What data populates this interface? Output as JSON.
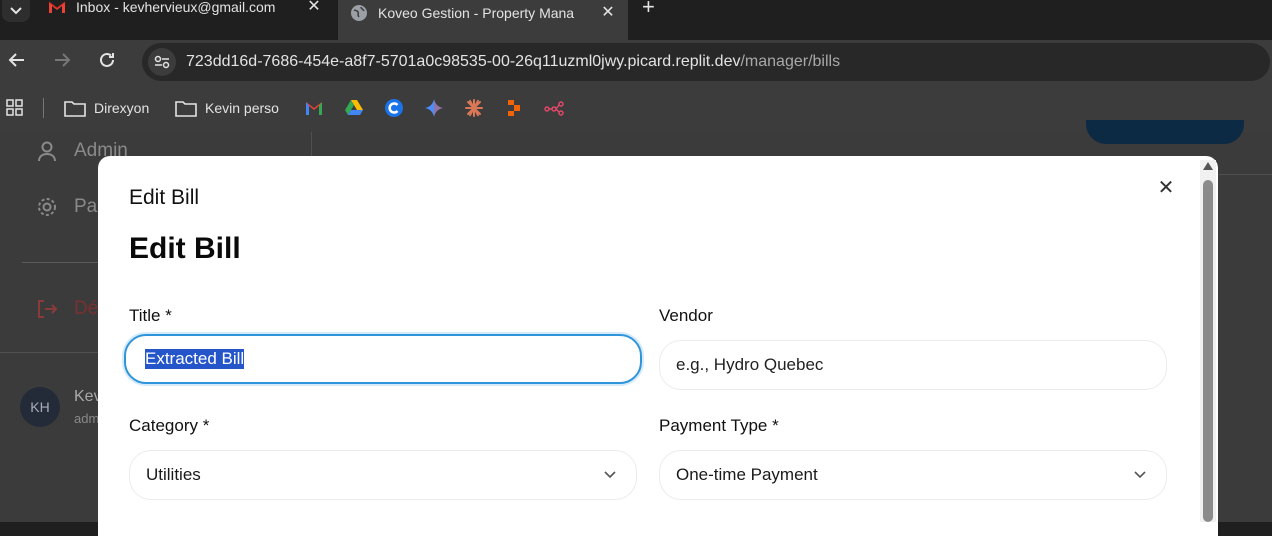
{
  "browser": {
    "tabs": [
      {
        "title": "Inbox - kevhervieux@gmail.com",
        "icon": "gmail-icon"
      },
      {
        "title": "Koveo Gestion - Property Mana",
        "icon": "globe-icon"
      }
    ],
    "url_host": "723dd16d-7686-454e-a8f7-5701a0c98535-00-26q11uzml0jwy.picard.replit.dev",
    "url_path": "/manager/bills",
    "bookmarks": [
      {
        "label": "Direxyon"
      },
      {
        "label": "Kevin perso"
      }
    ]
  },
  "sidebar": {
    "items": [
      {
        "label": "Admin"
      },
      {
        "label": "Pa"
      },
      {
        "label": "Dé"
      }
    ],
    "user": {
      "initials": "KH",
      "name": "Kev",
      "role": "adm"
    }
  },
  "modal": {
    "subtitle": "Edit Bill",
    "title": "Edit Bill",
    "fields": {
      "title": {
        "label": "Title *",
        "value": "Extracted Bill"
      },
      "vendor": {
        "label": "Vendor",
        "placeholder": "e.g., Hydro Quebec"
      },
      "category": {
        "label": "Category *",
        "value": "Utilities"
      },
      "payment_type": {
        "label": "Payment Type *",
        "value": "One-time Payment"
      }
    }
  },
  "colors": {
    "focus_ring": "#2f95db",
    "selection": "#2556c9",
    "browser_chrome": "#3c3c3c"
  }
}
